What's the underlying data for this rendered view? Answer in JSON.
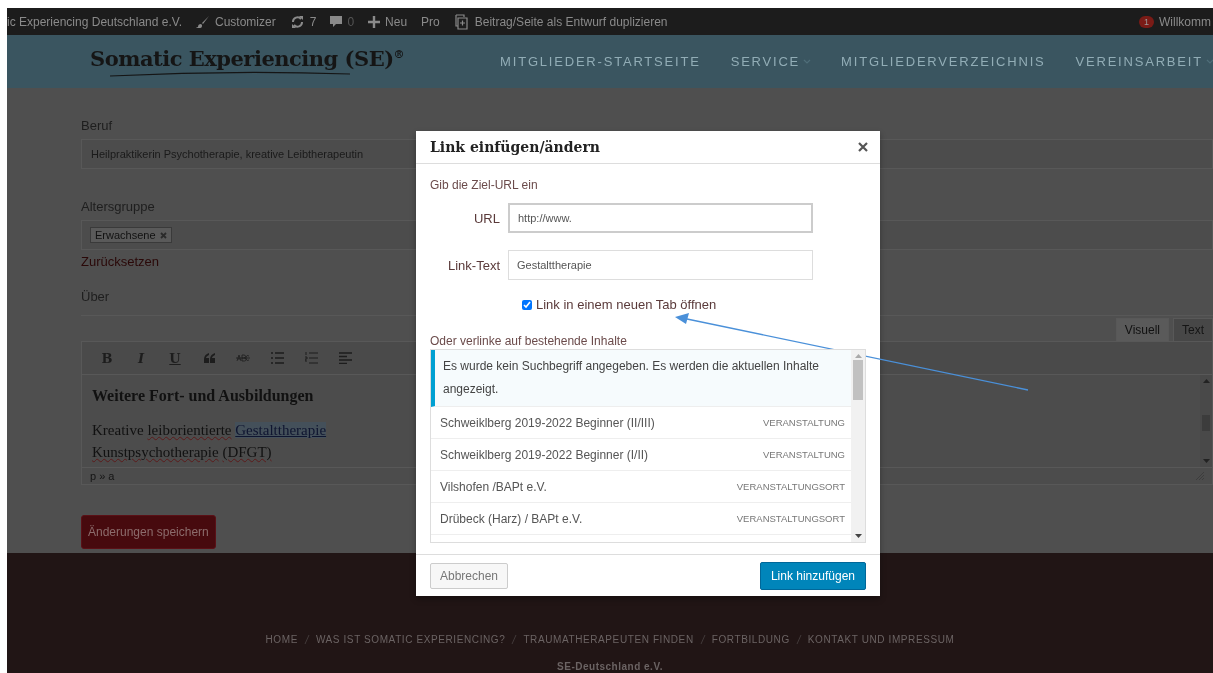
{
  "admin_bar": {
    "site": "ic Experiencing Deutschland e.V.",
    "customizer": "Customizer",
    "updates": "7",
    "comments": "0",
    "new": "Neu",
    "pro": "Pro",
    "duplicate": "Beitrag/Seite als Entwurf duplizieren",
    "notifications": "1",
    "greeting": "Willkomm"
  },
  "header": {
    "logo": "Somatic Experiencing (SE)$^{®}$",
    "nav": [
      {
        "label": "MITGLIEDER-STARTSEITE",
        "has_submenu": false
      },
      {
        "label": "SERVICE",
        "has_submenu": true
      },
      {
        "label": "MITGLIEDERVERZEICHNIS",
        "has_submenu": false
      },
      {
        "label": "VEREINSARBEIT",
        "has_submenu": true
      }
    ]
  },
  "form": {
    "occupation": {
      "label": "Beruf",
      "value": "Heilpraktikerin Psychotherapie, kreative Leibtherapeutin"
    },
    "age_group": {
      "label": "Altersgruppe",
      "tags": [
        "Erwachsene"
      ],
      "reset": "Zurücksetzen"
    },
    "about": {
      "label": "Über",
      "tabs": [
        {
          "label": "Visuell",
          "selected": true
        },
        {
          "label": "Text",
          "selected": false
        }
      ],
      "toolbar": [
        {
          "kind": "glyph",
          "glyph": "B"
        },
        {
          "kind": "glyph",
          "glyph": "I"
        },
        {
          "kind": "glyph",
          "glyph": "U"
        },
        {
          "kind": "quote"
        },
        {
          "kind": "strike"
        },
        {
          "kind": "bullets"
        },
        {
          "kind": "numbers"
        },
        {
          "kind": "align"
        }
      ],
      "heading": "Weitere Fort- und Ausbildungen",
      "paragraph": [
        {
          "kind": "plain",
          "text": "Kreative"
        },
        {
          "kind": "misspelled",
          "text": "leiborientierte"
        },
        {
          "kind": "link",
          "text": "Gestalttherapie"
        },
        {
          "kind": "misspelled",
          "text": "Kunstpsychotherapie"
        },
        {
          "kind": "misspelled",
          "text": "(DFGT)"
        }
      ],
      "path": "p » a"
    },
    "save": "Änderungen speichern"
  },
  "dialog": {
    "title": "Link einfügen/ändern",
    "intro": "Gib die Ziel-URL ein",
    "url": {
      "label": "URL",
      "value": "http://www."
    },
    "link_text": {
      "label": "Link-Text",
      "value": "Gestalttherapie"
    },
    "new_tab": {
      "label": "Link in einem neuen Tab öffnen",
      "checked": true
    },
    "existing_label": "Oder verlinke auf bestehende Inhalte",
    "notice": "Es wurde kein Suchbegriff angegeben. Es werden die aktuellen Inhalte angezeigt.",
    "results": [
      {
        "title": "Schweiklberg 2019-2022 Beginner (II/III)",
        "type": "VERANSTALTUNG"
      },
      {
        "title": "Schweiklberg 2019-2022 Beginner (I/II)",
        "type": "VERANSTALTUNG"
      },
      {
        "title": "Vilshofen /BAPt e.V.",
        "type": "VERANSTALTUNGSORT"
      },
      {
        "title": "Drübeck (Harz) / BAPt e.V.",
        "type": "VERANSTALTUNGSORT"
      }
    ],
    "cancel": "Abbrechen",
    "submit": "Link hinzufügen"
  },
  "footer": {
    "nav": [
      "HOME",
      "WAS IST SOMATIC EXPERIENCING?",
      "TRAUMATHERAPEUTEN FINDEN",
      "FORTBILDUNG",
      "KONTAKT UND IMPRESSUM"
    ],
    "org": "SE-Deutschland e.V."
  }
}
